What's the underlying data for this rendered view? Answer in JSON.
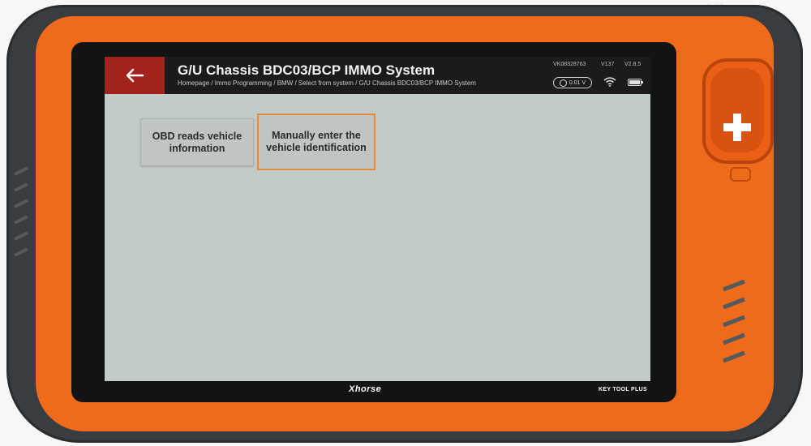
{
  "header": {
    "back_icon": "arrow-left-icon",
    "title": "G/U Chassis BDC03/BCP IMMO System",
    "breadcrumb": "Homepage / Immo Programming / BMW / Select from  system / G/U Chassis BDC03/BCP IMMO System",
    "serial": "VK08328763",
    "hw_version": "V137",
    "app_version": "V2.8.5",
    "battery_voltage": "0.01 V",
    "wifi_icon": "wifi-icon",
    "battery_icon": "battery-icon"
  },
  "options": [
    {
      "label": "OBD reads vehicle information"
    },
    {
      "label": "Manually enter the vehicle identification"
    }
  ],
  "device": {
    "brand": "Xhorse",
    "model": "KEY TOOL PLUS",
    "watermark": "Xhorse",
    "accent_color": "#f06a1c",
    "back_button_color": "#a2231c"
  }
}
